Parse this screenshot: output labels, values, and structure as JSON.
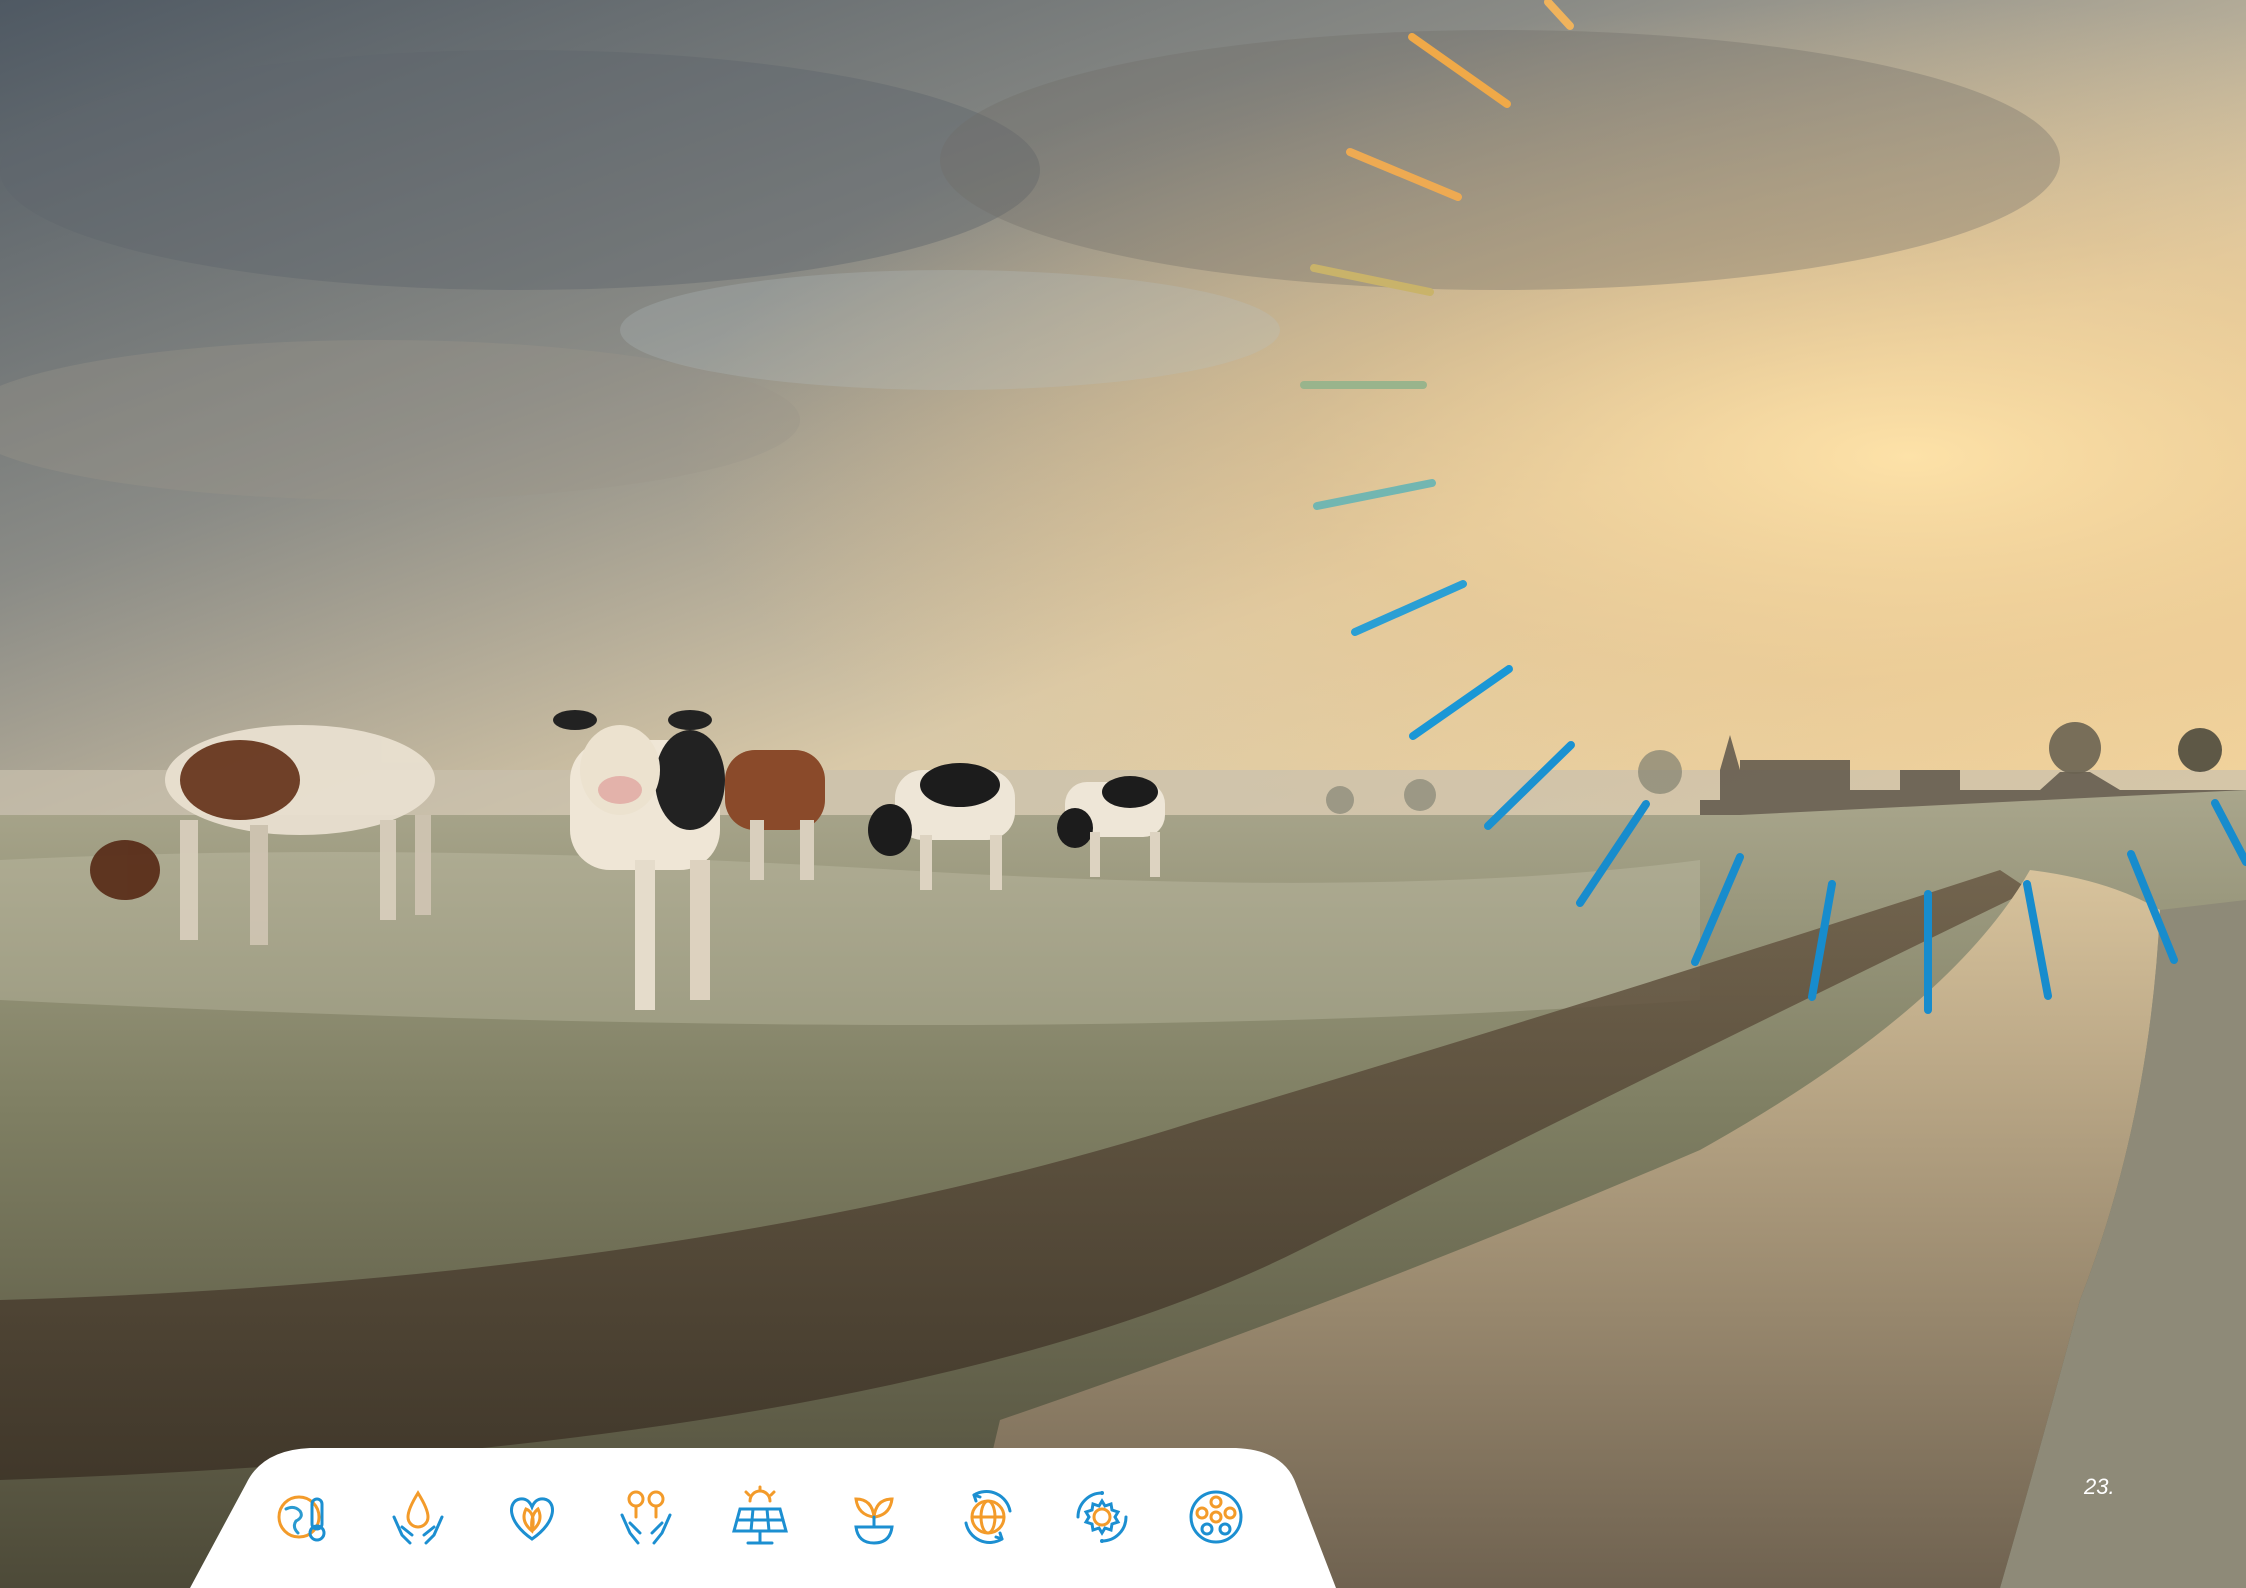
{
  "page": {
    "number": "23."
  },
  "colors": {
    "sky_top": "#5d6770",
    "sky_glow": "#f2d7a6",
    "field": "#8d8f72",
    "water": "#9a8b70",
    "ray_warm": "#f0a948",
    "ray_mid": "#72b6b1",
    "ray_cool": "#1a8fd0",
    "icon_gradient_start": "#f39b2a",
    "icon_gradient_end": "#1c8fd1",
    "icon_bar": "#ffffff"
  },
  "theme_icons": [
    {
      "name": "climate-thermometer-icon"
    },
    {
      "name": "water-in-hands-icon"
    },
    {
      "name": "leaf-heart-icon"
    },
    {
      "name": "people-with-trees-icon"
    },
    {
      "name": "solar-panel-icon"
    },
    {
      "name": "sprout-icon"
    },
    {
      "name": "globe-cycle-icon"
    },
    {
      "name": "gear-cycle-icon"
    },
    {
      "name": "community-circle-icon"
    }
  ]
}
